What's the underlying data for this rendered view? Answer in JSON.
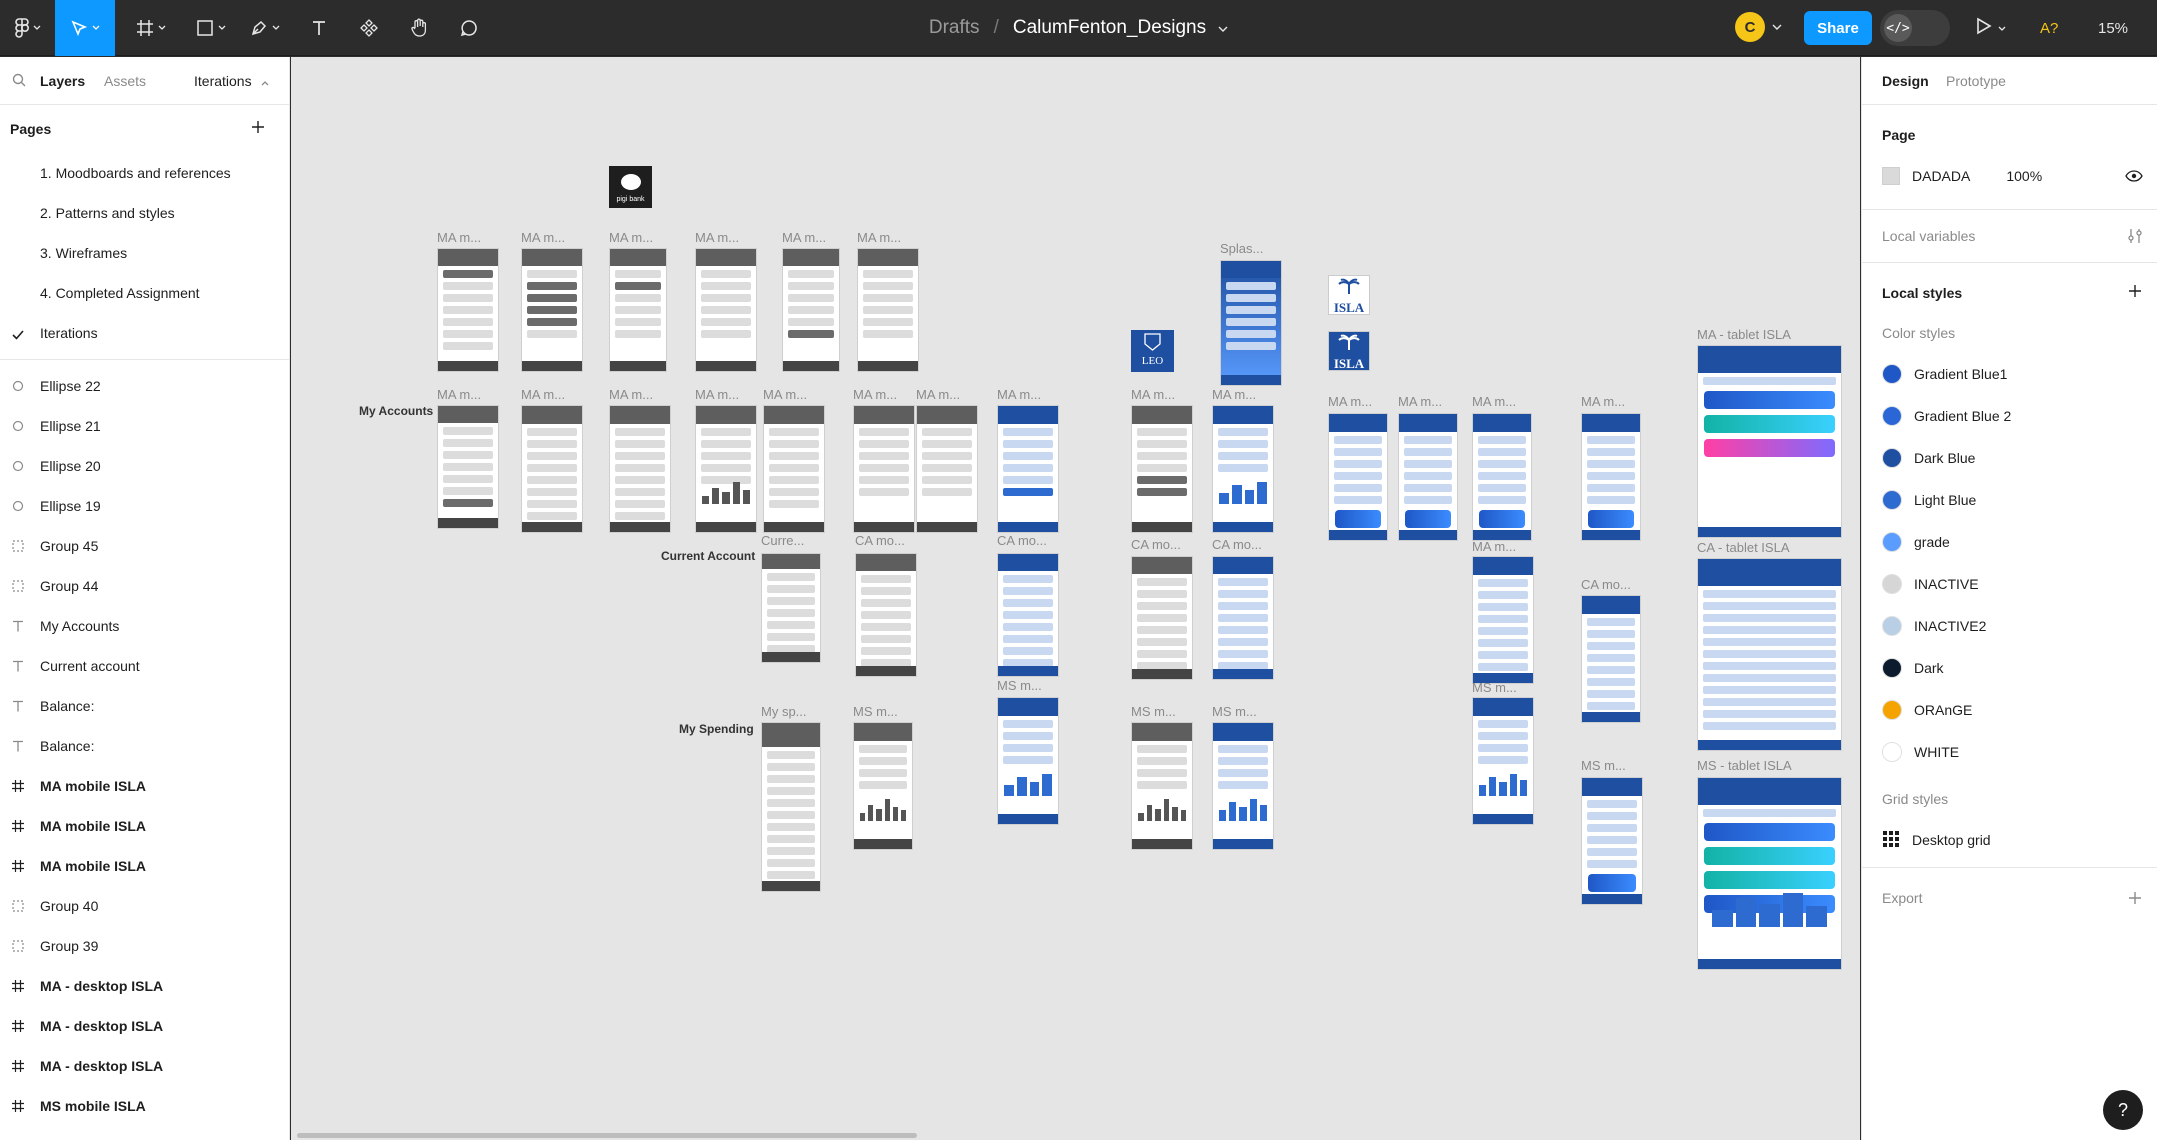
{
  "toolbar": {
    "breadcrumb_parent": "Drafts",
    "breadcrumb_separator": "/",
    "file_name": "CalumFenton_Designs",
    "avatar_initial": "C",
    "share_label": "Share",
    "dev_mode_glyph": "</>",
    "ai_label": "A?",
    "zoom_label": "15%",
    "accent_color": "#0d99ff"
  },
  "left_panel": {
    "tabs": {
      "layers": "Layers",
      "assets": "Assets",
      "iterations": "Iterations"
    },
    "pages_title": "Pages",
    "pages": [
      {
        "label": "1. Moodboards and references",
        "active": false
      },
      {
        "label": "2. Patterns and styles",
        "active": false
      },
      {
        "label": "3. Wireframes",
        "active": false
      },
      {
        "label": "4. Completed Assignment",
        "active": false
      },
      {
        "label": "Iterations",
        "active": true
      }
    ],
    "layers": [
      {
        "label": "Ellipse 22",
        "icon": "ellipse-icon"
      },
      {
        "label": "Ellipse 21",
        "icon": "ellipse-icon"
      },
      {
        "label": "Ellipse 20",
        "icon": "ellipse-icon"
      },
      {
        "label": "Ellipse 19",
        "icon": "ellipse-icon"
      },
      {
        "label": "Group 45",
        "icon": "group-icon"
      },
      {
        "label": "Group 44",
        "icon": "group-icon"
      },
      {
        "label": "My Accounts",
        "icon": "text-icon"
      },
      {
        "label": "Current account",
        "icon": "text-icon"
      },
      {
        "label": "Balance:",
        "icon": "text-icon"
      },
      {
        "label": "Balance:",
        "icon": "text-icon"
      },
      {
        "label": "MA mobile ISLA",
        "icon": "frame-icon"
      },
      {
        "label": "MA mobile ISLA",
        "icon": "frame-icon"
      },
      {
        "label": "MA mobile ISLA",
        "icon": "frame-icon"
      },
      {
        "label": "Group 40",
        "icon": "group-icon"
      },
      {
        "label": "Group 39",
        "icon": "group-icon"
      },
      {
        "label": "MA - desktop ISLA",
        "icon": "frame-icon"
      },
      {
        "label": "MA - desktop ISLA",
        "icon": "frame-icon"
      },
      {
        "label": "MA - desktop ISLA",
        "icon": "frame-icon"
      },
      {
        "label": "MS mobile ISLA",
        "icon": "frame-icon"
      }
    ]
  },
  "canvas": {
    "background": "#e5e5e5",
    "section_labels": {
      "my_accounts": "My Accounts",
      "current_account": "Current Account",
      "my_spending": "My Spending"
    },
    "frame_labels": {
      "ma": "MA m...",
      "splash": "Splas...",
      "curre": "Curre...",
      "ca": "CA mo...",
      "ms_short": "MS m...",
      "my_sp": "My sp...",
      "ma_tablet": "MA - tablet ISLA",
      "ca_tablet": "CA - tablet ISLA",
      "ms_tablet": "MS - tablet ISLA"
    },
    "logos": {
      "piggy": "pigi bank",
      "leo": "LEO",
      "isla": "ISLA"
    }
  },
  "right_panel": {
    "tabs": {
      "design": "Design",
      "prototype": "Prototype"
    },
    "page_title": "Page",
    "page_color": "DADADA",
    "page_opacity": "100%",
    "local_variables": "Local variables",
    "local_styles": "Local styles",
    "color_styles_title": "Color styles",
    "color_styles": [
      {
        "name": "Gradient Blue1",
        "color": "#1f57c6"
      },
      {
        "name": "Gradient Blue 2",
        "color": "#2a66d6"
      },
      {
        "name": "Dark Blue",
        "color": "#1f4fa0"
      },
      {
        "name": "Light Blue",
        "color": "#2e6bd1"
      },
      {
        "name": "grade",
        "color": "#5a9cff"
      },
      {
        "name": "INACTIVE",
        "color": "#d6d6d6"
      },
      {
        "name": "INACTIVE2",
        "color": "#b9cfe6"
      },
      {
        "name": "Dark",
        "color": "#0d1b2e"
      },
      {
        "name": "ORAnGE",
        "color": "#f5a300"
      },
      {
        "name": "WHITE",
        "color": "#ffffff"
      }
    ],
    "grid_styles_title": "Grid styles",
    "grid_style": "Desktop grid",
    "export_title": "Export"
  },
  "help_glyph": "?"
}
